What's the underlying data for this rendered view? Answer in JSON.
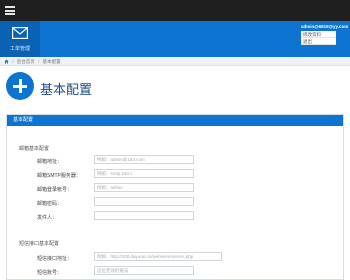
{
  "header": {
    "module_label": "工单管理",
    "username": "admin@6818@yy.com",
    "account_menu": [
      "修改资料",
      "退出"
    ]
  },
  "breadcrumb": {
    "items": [
      "后台首页",
      "基本配置"
    ]
  },
  "page": {
    "title": "基本配置"
  },
  "panel": {
    "title": "基本配置",
    "mail_section": {
      "title": "邮箱基本配置",
      "fields": [
        {
          "label": "邮箱地址：",
          "placeholder": "例如：admin@163.com",
          "value": ""
        },
        {
          "label": "邮箱SMTP服务器：",
          "placeholder": "例如：smtp.163.c",
          "value": ""
        },
        {
          "label": "邮箱登录帐号：",
          "placeholder": "例如：admin",
          "value": ""
        },
        {
          "label": "邮箱密码：",
          "placeholder": "",
          "value": ""
        },
        {
          "label": "发件人：",
          "placeholder": "",
          "value": ""
        }
      ]
    },
    "sms_section": {
      "title": "短信接口基本配置",
      "fields": [
        {
          "label": "短信接口地址：",
          "placeholder": "例如：http://100.dayuan.cn/webservice/sms.php",
          "value": ""
        },
        {
          "label": "短信账号：",
          "placeholder": "这位无效的账号",
          "value": ""
        }
      ]
    }
  },
  "colors": {
    "accent": "#0d74d1",
    "topbar": "#1f1f1f",
    "breadcrumb_bg": "#eef2f6"
  },
  "icons": {
    "menu": "hamburger-icon",
    "module": "mail-icon",
    "breadcrumb_home": "home-icon",
    "title": "plus-circle-icon"
  }
}
